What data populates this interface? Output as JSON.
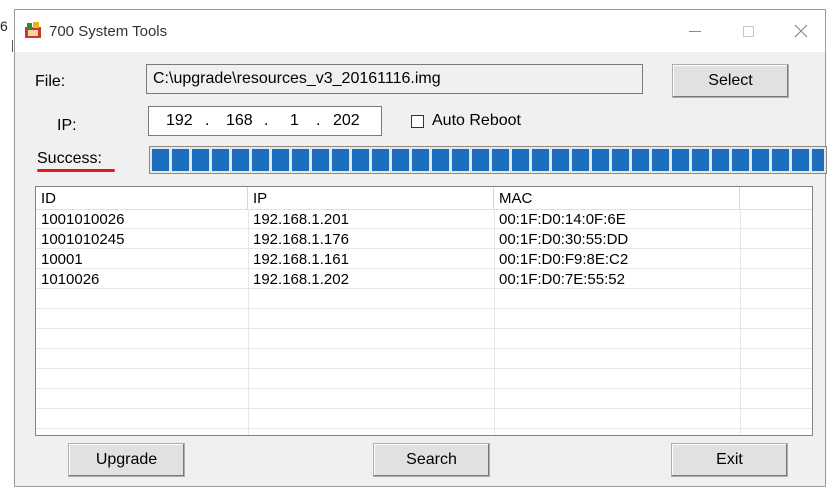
{
  "stray_text": "6",
  "window": {
    "title": "700 System Tools",
    "minimize_icon": "minimize-icon",
    "maximize_icon": "maximize-icon",
    "close_icon": "close-icon"
  },
  "file": {
    "label": "File:",
    "value": "C:\\upgrade\\resources_v3_20161116.img",
    "select_label": "Select"
  },
  "ip": {
    "label": "IP:",
    "octets": [
      "192",
      "168",
      "1",
      "202"
    ],
    "dot": ".",
    "auto_reboot_label": "Auto Reboot",
    "auto_reboot_checked": false
  },
  "status": {
    "label": "Success:",
    "progress_fraction": 1.0,
    "bar_color": "#1d6fbe",
    "underline_color": "#e01c1c"
  },
  "table": {
    "columns": [
      "ID",
      "IP",
      "MAC"
    ],
    "rows": [
      [
        "1001010026",
        "192.168.1.201",
        "00:1F:D0:14:0F:6E"
      ],
      [
        "1001010245",
        "192.168.1.176",
        "00:1F:D0:30:55:DD"
      ],
      [
        "10001",
        "192.168.1.161",
        "00:1F:D0:F9:8E:C2"
      ],
      [
        "1010026",
        "192.168.1.202",
        "00:1F:D0:7E:55:52"
      ]
    ]
  },
  "buttons": {
    "upgrade": "Upgrade",
    "search": "Search",
    "exit": "Exit"
  }
}
